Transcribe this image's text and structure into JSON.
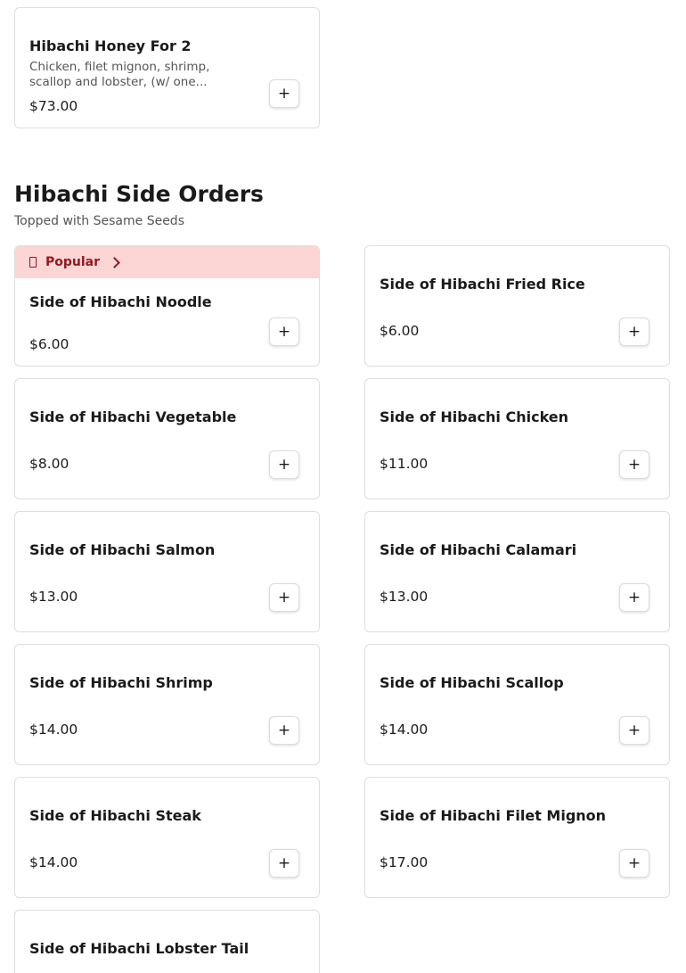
{
  "top_item": {
    "name": "Hibachi Honey For 2",
    "description": "Chicken, filet mignon, shrimp, scallop and lobster, (w/ one...",
    "price": "$73.00"
  },
  "add_button_label": "+",
  "section": {
    "title": "Hibachi Side Orders",
    "subtitle": "Topped with Sesame Seeds",
    "popular_label": "Popular",
    "items": [
      {
        "name": "Side of Hibachi Noodle",
        "price": "$6.00"
      },
      {
        "name": "Side of Hibachi Fried Rice",
        "price": "$6.00"
      },
      {
        "name": "Side of Hibachi Vegetable",
        "price": "$8.00"
      },
      {
        "name": "Side of Hibachi Chicken",
        "price": "$11.00"
      },
      {
        "name": "Side of Hibachi Salmon",
        "price": "$13.00"
      },
      {
        "name": "Side of Hibachi Calamari",
        "price": "$13.00"
      },
      {
        "name": "Side of Hibachi Shrimp",
        "price": "$14.00"
      },
      {
        "name": "Side of Hibachi Scallop",
        "price": "$14.00"
      },
      {
        "name": "Side of Hibachi Steak",
        "price": "$14.00"
      },
      {
        "name": "Side of Hibachi Filet Mignon",
        "price": "$17.00"
      },
      {
        "name": "Side of Hibachi Lobster Tail"
      }
    ]
  },
  "colors": {
    "popular_background": "#fcd5d5",
    "popular_text": "#8c1c22",
    "card_border": "#dedede"
  }
}
